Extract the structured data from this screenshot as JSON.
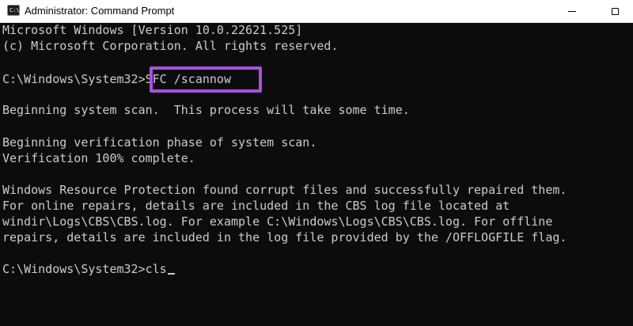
{
  "window": {
    "title": "Administrator: Command Prompt",
    "icon": "command-prompt-icon",
    "icon_text": "C:\\",
    "controls": {
      "minimize": "minimize-icon",
      "maximize": "maximize-icon"
    }
  },
  "console": {
    "header": [
      "Microsoft Windows [Version 10.0.22621.525]",
      "(c) Microsoft Corporation. All rights reserved."
    ],
    "prompt1": "C:\\Windows\\System32>",
    "command1": "SFC /scannow",
    "output": [
      "Beginning system scan.  This process will take some time.",
      "Beginning verification phase of system scan.",
      "Verification 100% complete.",
      "Windows Resource Protection found corrupt files and successfully repaired them.",
      "For online repairs, details are included in the CBS log file located at",
      "windir\\Logs\\CBS\\CBS.log. For example C:\\Windows\\Logs\\CBS\\CBS.log. For offline",
      "repairs, details are included in the log file provided by the /OFFLOGFILE flag."
    ],
    "prompt2": "C:\\Windows\\System32>",
    "command2": "cls"
  },
  "colors": {
    "background": "#0c0c0c",
    "text": "#cccccc",
    "highlight_border": "#a950e0",
    "titlebar": "#ffffff"
  }
}
